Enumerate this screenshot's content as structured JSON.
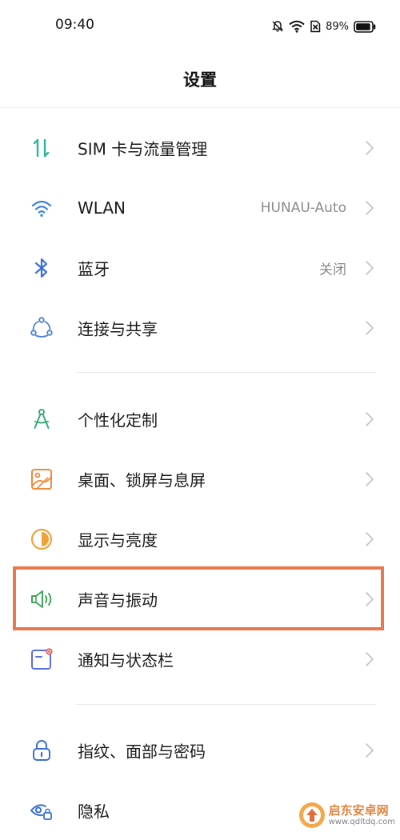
{
  "status_bar": {
    "time": "09:40",
    "battery": "89%"
  },
  "header": {
    "title": "设置"
  },
  "settings": [
    {
      "label": "SIM 卡与流量管理",
      "value": "",
      "icon": "sim-data-icon",
      "color": "#2bb5a0"
    },
    {
      "label": "WLAN",
      "value": "HUNAU-Auto",
      "icon": "wifi-icon",
      "color": "#3b82e6"
    },
    {
      "label": "蓝牙",
      "value": "关闭",
      "icon": "bluetooth-icon",
      "color": "#3b6fd6"
    },
    {
      "label": "连接与共享",
      "value": "",
      "icon": "connection-share-icon",
      "color": "#4a7fd8"
    },
    {
      "label": "个性化定制",
      "value": "",
      "icon": "personalization-icon",
      "color": "#3aaa7a"
    },
    {
      "label": "桌面、锁屏与息屏",
      "value": "",
      "icon": "wallpaper-icon",
      "color": "#f08a3c"
    },
    {
      "label": "显示与亮度",
      "value": "",
      "icon": "display-brightness-icon",
      "color": "#f0a238"
    },
    {
      "label": "声音与振动",
      "value": "",
      "icon": "speaker-icon",
      "color": "#3fa65a"
    },
    {
      "label": "通知与状态栏",
      "value": "",
      "icon": "notification-icon",
      "color": "#5a6fe0"
    },
    {
      "label": "指纹、面部与密码",
      "value": "",
      "icon": "lock-icon",
      "color": "#3b6fd6"
    },
    {
      "label": "隐私",
      "value": "",
      "icon": "privacy-icon",
      "color": "#3b6fd6"
    }
  ],
  "highlight_color": "#e8794e",
  "watermark": {
    "title": "启东安卓网",
    "url": "www.qdltdq.com"
  }
}
